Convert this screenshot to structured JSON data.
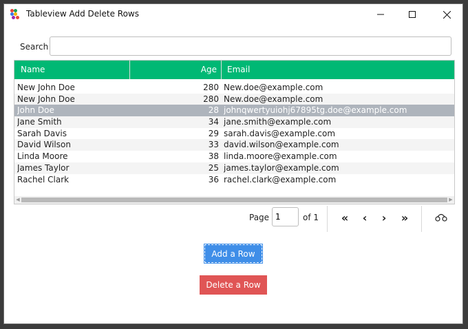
{
  "window": {
    "title": "Tableview Add Delete Rows"
  },
  "search": {
    "label": "Search",
    "value": "",
    "placeholder": ""
  },
  "table": {
    "headers": {
      "name": "Name",
      "age": "Age",
      "email": "Email"
    },
    "rows": [
      {
        "name": "New John Doe",
        "age": "280",
        "email": "New.doe@example.com"
      },
      {
        "name": "New John Doe",
        "age": "280",
        "email": "New.doe@example.com"
      },
      {
        "name": "John Doe",
        "age": "28",
        "email": "johnqwertyuiohj67895tg.doe@example.com",
        "selected": true
      },
      {
        "name": "Jane Smith",
        "age": "34",
        "email": "jane.smith@example.com"
      },
      {
        "name": "Sarah Davis",
        "age": "29",
        "email": "sarah.davis@example.com"
      },
      {
        "name": "David Wilson",
        "age": "33",
        "email": "david.wilson@example.com"
      },
      {
        "name": "Linda Moore",
        "age": "38",
        "email": "linda.moore@example.com"
      },
      {
        "name": "James Taylor",
        "age": "25",
        "email": "james.taylor@example.com"
      },
      {
        "name": "Rachel Clark",
        "age": "36",
        "email": "rachel.clark@example.com"
      }
    ]
  },
  "pagination": {
    "page_label": "Page",
    "current_page": "1",
    "of_label": "of 1",
    "first": "«",
    "prev": "‹",
    "next": "›",
    "last": "»"
  },
  "buttons": {
    "add": "Add a Row",
    "delete": "Delete a Row"
  },
  "colors": {
    "header": "#00b874",
    "selected_row": "#aeb4bc",
    "add_button": "#3f8ee8",
    "delete_button": "#e05555"
  },
  "icons": {
    "app": "app-dots-icon",
    "minimize": "minimize-icon",
    "maximize": "maximize-icon",
    "close": "close-icon",
    "pager_extra": "link-icon"
  }
}
